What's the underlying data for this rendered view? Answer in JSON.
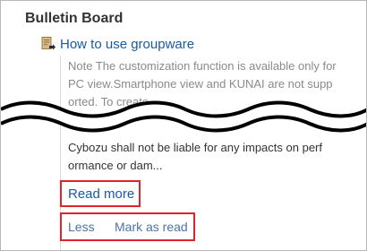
{
  "board": {
    "title": "Bulletin Board"
  },
  "post": {
    "icon": "bulletin-post-icon",
    "title": "How to use groupware",
    "excerpt_top": "Note The customization function is available only for\nPC view.Smartphone view and KUNAI are not supp\norted. To create...",
    "excerpt_bottom": "Cybozu shall not be liable for any impacts on perf\normance or dam..."
  },
  "actions": {
    "read_more": "Read more",
    "less": "Less",
    "mark_as_read": "Mark as read"
  },
  "colors": {
    "link": "#1a5aa0",
    "highlight_border": "#e0242b",
    "muted_text": "#8a8a8a"
  }
}
